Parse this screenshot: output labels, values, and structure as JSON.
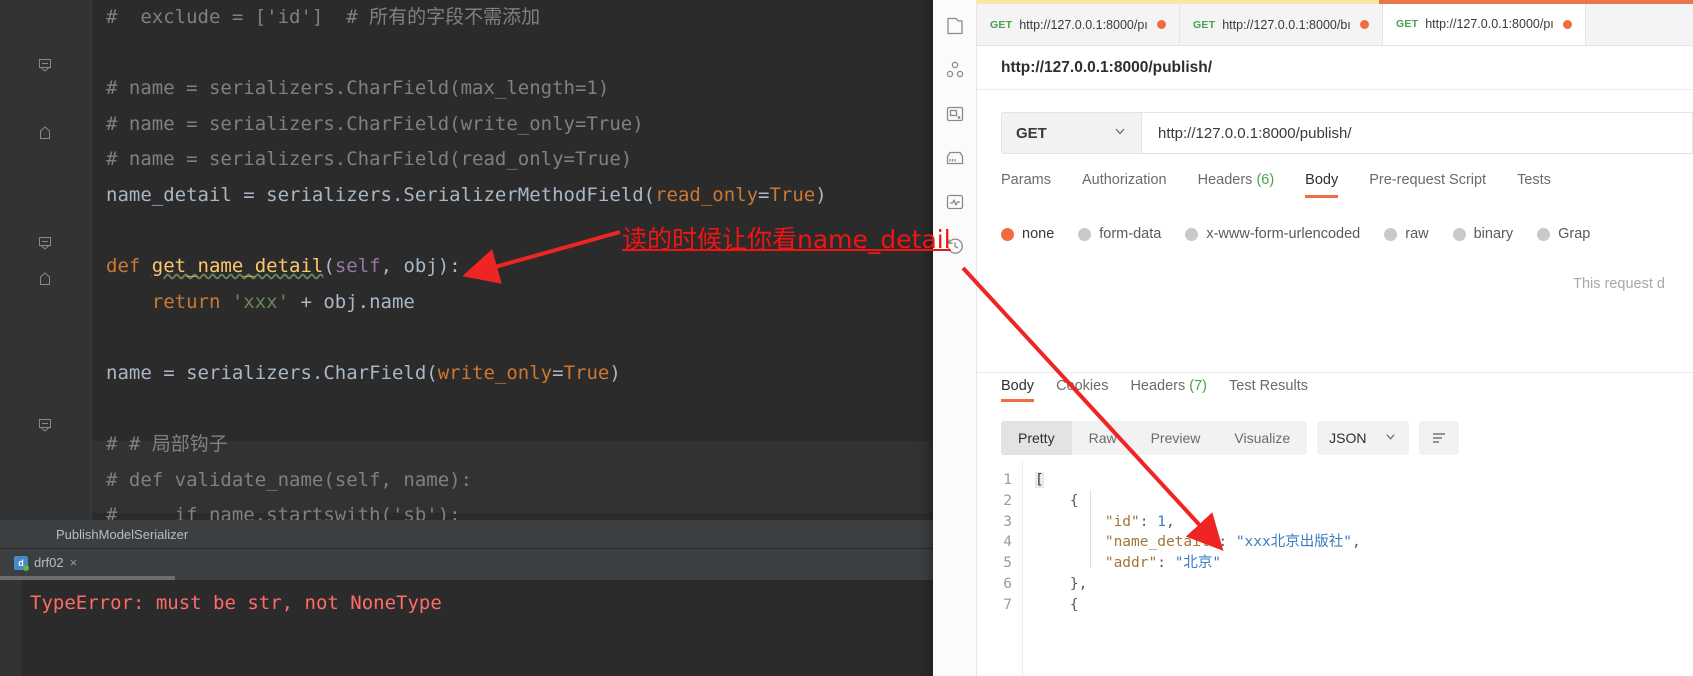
{
  "ide": {
    "code_lines": [
      {
        "indent": 0,
        "segments": [
          {
            "t": "#  exclude = ['id']  # 所有的字段不需添加",
            "c": "cmt"
          }
        ]
      },
      {
        "indent": 0,
        "segments": []
      },
      {
        "indent": 0,
        "segments": [
          {
            "t": "# name = serializers.CharField(max_length=1)",
            "c": "cmt"
          }
        ]
      },
      {
        "indent": 0,
        "segments": [
          {
            "t": "# name = serializers.CharField(write_only=True)",
            "c": "cmt"
          }
        ]
      },
      {
        "indent": 0,
        "segments": [
          {
            "t": "# name = serializers.CharField(read_only=True)",
            "c": "cmt"
          }
        ]
      },
      {
        "indent": 0,
        "segments": [
          {
            "t": "name_detail = serializers.SerializerMethodField(",
            "c": "nm"
          },
          {
            "t": "read_only",
            "c": "kw"
          },
          {
            "t": "=",
            "c": "nm"
          },
          {
            "t": "True",
            "c": "kw"
          },
          {
            "t": ")",
            "c": "nm"
          }
        ]
      },
      {
        "indent": 0,
        "segments": []
      },
      {
        "indent": 0,
        "segments": [
          {
            "t": "def ",
            "c": "kw"
          },
          {
            "t": "get_name_detail",
            "c": "fn"
          },
          {
            "t": "(",
            "c": "nm"
          },
          {
            "t": "self",
            "c": "par"
          },
          {
            "t": ", obj):",
            "c": "nm"
          }
        ]
      },
      {
        "indent": 0,
        "segments": [
          {
            "t": "    return ",
            "c": "kw"
          },
          {
            "t": "'xxx'",
            "c": "str"
          },
          {
            "t": " + obj.name",
            "c": "nm"
          }
        ]
      },
      {
        "indent": 0,
        "segments": []
      },
      {
        "indent": 0,
        "segments": [
          {
            "t": "name = serializers.CharField(",
            "c": "nm"
          },
          {
            "t": "write_only",
            "c": "kw"
          },
          {
            "t": "=",
            "c": "nm"
          },
          {
            "t": "True",
            "c": "kw"
          },
          {
            "t": ")",
            "c": "nm"
          }
        ]
      },
      {
        "indent": 0,
        "segments": []
      },
      {
        "indent": 0,
        "segments": [
          {
            "t": "# # 局部钩子",
            "c": "cmt"
          }
        ]
      },
      {
        "indent": 0,
        "segments": [
          {
            "t": "# def validate_name(self, name):",
            "c": "cmt"
          }
        ]
      },
      {
        "indent": 0,
        "segments": [
          {
            "t": "#     if name.startswith('sb'):",
            "c": "cmt"
          }
        ]
      }
    ],
    "breadcrumb": "PublishModelSerializer",
    "run_tab": {
      "label": "drf02",
      "icon": "python-run-icon",
      "close": "×"
    },
    "console_error": "TypeError: must be str, not NoneType"
  },
  "annotation": {
    "text": "读的时候让你看name_detail",
    "color": "#f01414",
    "arrow_1": "arrow-to-return-line",
    "arrow_2": "arrow-to-json-name-detail"
  },
  "postman": {
    "sidebar_icons": [
      "collections-icon",
      "apis-icon",
      "environments-icon",
      "mock-servers-icon",
      "monitors-icon",
      "history-icon"
    ],
    "tabs": [
      {
        "method": "GET",
        "url": "http://127.0.0.1:8000/pı",
        "unsaved": true,
        "active": false
      },
      {
        "method": "GET",
        "url": "http://127.0.0.1:8000/bı",
        "unsaved": true,
        "active": false
      },
      {
        "method": "GET",
        "url": "http://127.0.0.1:8000/pı",
        "unsaved": true,
        "active": true
      }
    ],
    "request_name": "http://127.0.0.1:8000/publish/",
    "method": "GET",
    "method_caret": "chevron-down-icon",
    "url": "http://127.0.0.1:8000/publish/",
    "request_tabs": [
      {
        "label": "Params",
        "active": false
      },
      {
        "label": "Authorization",
        "active": false
      },
      {
        "label": "Headers",
        "count": "(6)",
        "active": false
      },
      {
        "label": "Body",
        "active": true
      },
      {
        "label": "Pre-request Script",
        "active": false
      },
      {
        "label": "Tests",
        "active": false
      }
    ],
    "body_types": [
      {
        "label": "none",
        "selected": true
      },
      {
        "label": "form-data",
        "selected": false
      },
      {
        "label": "x-www-form-urlencoded",
        "selected": false
      },
      {
        "label": "raw",
        "selected": false
      },
      {
        "label": "binary",
        "selected": false
      },
      {
        "label": "Grap",
        "selected": false
      }
    ],
    "no_body_text": "This request d",
    "response_tabs": [
      {
        "label": "Body",
        "active": true
      },
      {
        "label": "Cookies",
        "active": false
      },
      {
        "label": "Headers",
        "count": "(7)",
        "active": false
      },
      {
        "label": "Test Results",
        "active": false
      }
    ],
    "view_modes": [
      {
        "label": "Pretty",
        "active": true
      },
      {
        "label": "Raw",
        "active": false
      },
      {
        "label": "Preview",
        "active": false
      },
      {
        "label": "Visualize",
        "active": false
      }
    ],
    "format": "JSON",
    "format_caret": "chevron-down-icon",
    "wrap_icon": "text-wrap-icon",
    "response_lines": [
      {
        "n": "1",
        "segments": [
          {
            "t": "[",
            "c": "jbracket"
          }
        ]
      },
      {
        "n": "2",
        "segments": [
          {
            "t": "    {",
            "c": "jpunct"
          }
        ]
      },
      {
        "n": "3",
        "segments": [
          {
            "t": "        ",
            "c": "jpunct"
          },
          {
            "t": "\"id\"",
            "c": "jkey"
          },
          {
            "t": ": ",
            "c": "jpunct"
          },
          {
            "t": "1",
            "c": "jnum"
          },
          {
            "t": ",",
            "c": "jpunct"
          }
        ]
      },
      {
        "n": "4",
        "segments": [
          {
            "t": "        ",
            "c": "jpunct"
          },
          {
            "t": "\"name_detail\"",
            "c": "jkey"
          },
          {
            "t": ": ",
            "c": "jpunct"
          },
          {
            "t": "\"xxx北京出版社\"",
            "c": "jstr"
          },
          {
            "t": ",",
            "c": "jpunct"
          }
        ]
      },
      {
        "n": "5",
        "segments": [
          {
            "t": "        ",
            "c": "jpunct"
          },
          {
            "t": "\"addr\"",
            "c": "jkey"
          },
          {
            "t": ": ",
            "c": "jpunct"
          },
          {
            "t": "\"北京\"",
            "c": "jstr"
          }
        ]
      },
      {
        "n": "6",
        "segments": [
          {
            "t": "    },",
            "c": "jpunct"
          }
        ]
      },
      {
        "n": "7",
        "segments": [
          {
            "t": "    {",
            "c": "jpunct"
          }
        ]
      }
    ]
  }
}
